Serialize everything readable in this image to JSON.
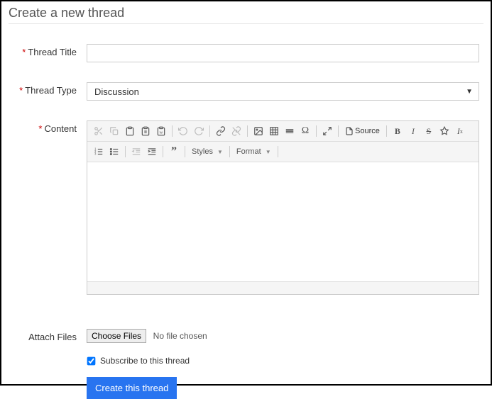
{
  "page": {
    "title": "Create a new thread"
  },
  "labels": {
    "thread_title": "Thread Title",
    "thread_type": "Thread Type",
    "content": "Content",
    "attach_files": "Attach Files"
  },
  "fields": {
    "thread_title_value": "",
    "thread_type_selected": "Discussion"
  },
  "editor": {
    "toolbar": {
      "source_label": "Source",
      "styles_label": "Styles",
      "format_label": "Format"
    }
  },
  "attach": {
    "button_label": "Choose Files",
    "status_text": "No file chosen"
  },
  "subscribe": {
    "label": "Subscribe to this thread",
    "checked": true
  },
  "submit": {
    "label": "Create this thread"
  },
  "required_marker": "*"
}
